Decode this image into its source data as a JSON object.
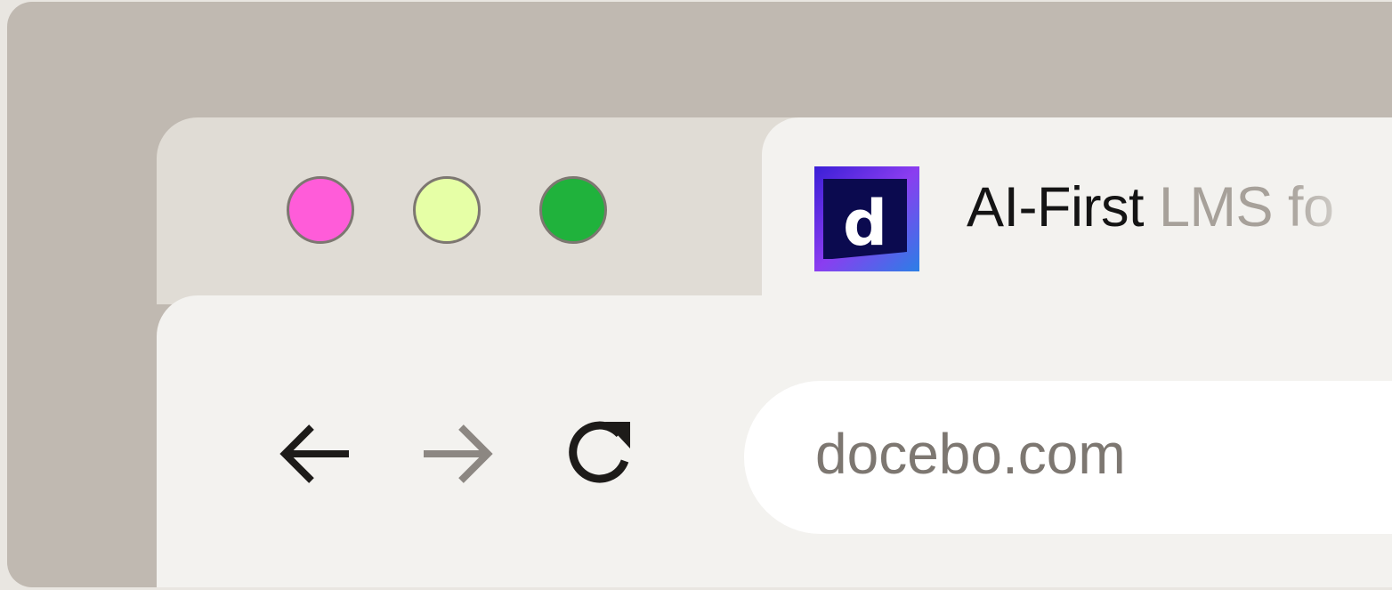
{
  "tab": {
    "title_strong": "AI-First",
    "title_faded": " LMS fo",
    "favicon_letter": "d"
  },
  "address_bar": {
    "url": "docebo.com"
  },
  "colors": {
    "backdrop": "#c0b9b1",
    "titlebar": "#e0dcd5",
    "toolbar": "#f3f2ef",
    "close": "#ff5cd9",
    "minimize": "#e6ffa6",
    "maximize": "#20b23c",
    "favicon_bg": "#0d0b55",
    "favicon_accent": "#7b3ff2"
  },
  "icons": [
    "back-arrow-icon",
    "forward-arrow-icon",
    "reload-icon",
    "docebo-favicon-icon"
  ]
}
